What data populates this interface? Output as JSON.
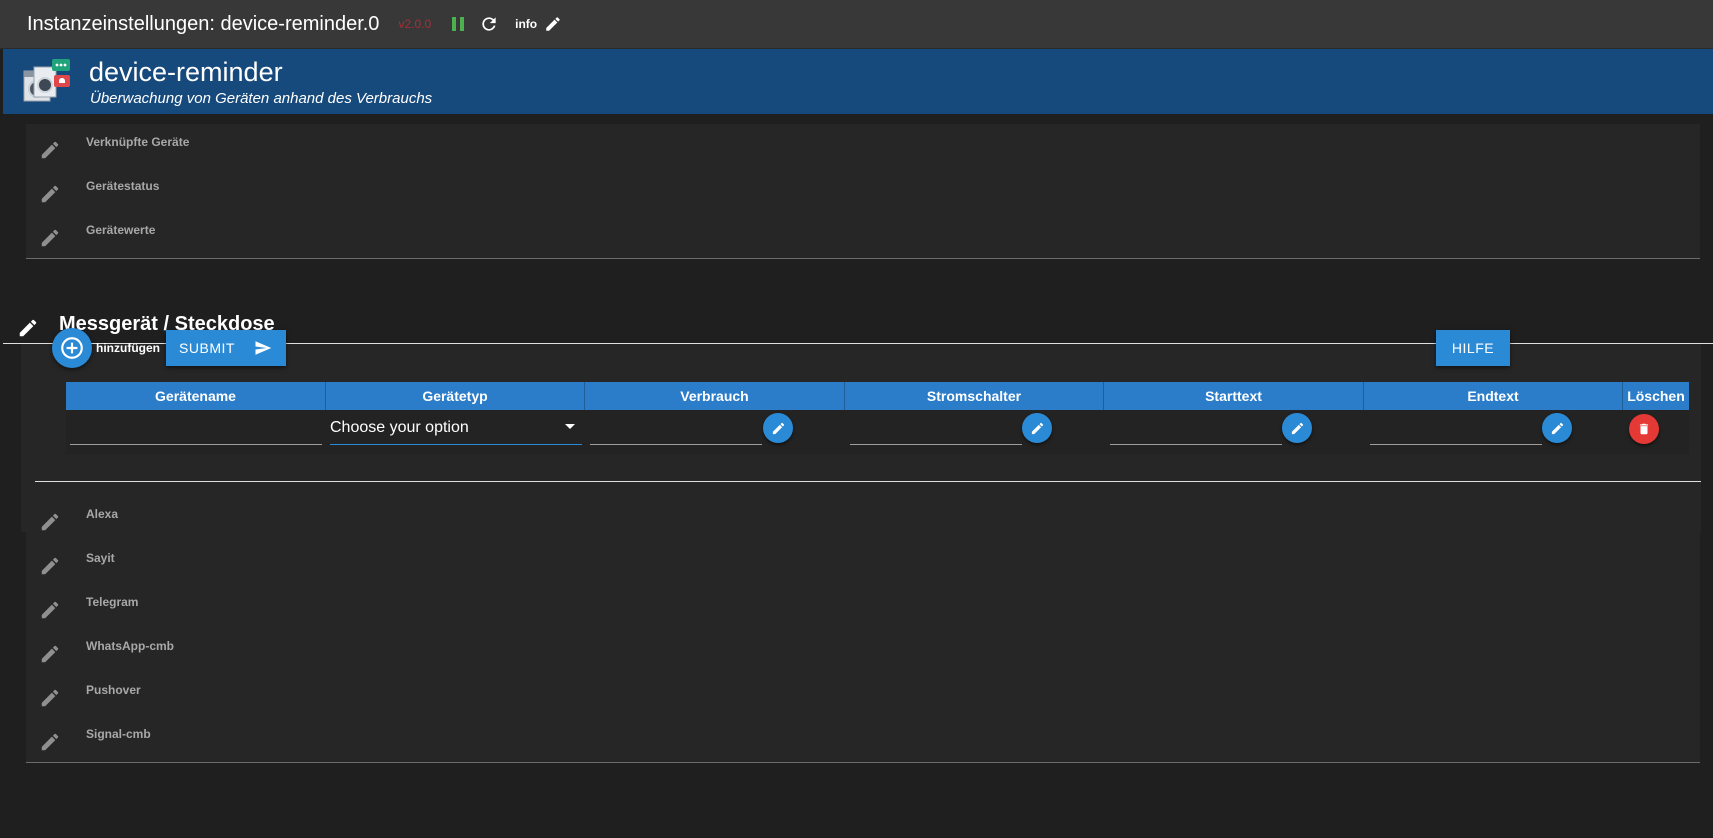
{
  "topbar": {
    "title": "Instanzeinstellungen: device-reminder.0",
    "version": "v2.0.0",
    "info_label": "info",
    "icons": [
      "pause-icon",
      "reload-icon",
      "edit-icon"
    ]
  },
  "header": {
    "name": "device-reminder",
    "description": "Überwachung von Geräten anhand des Verbrauchs"
  },
  "panels_top": [
    {
      "label": "Verknüpfte Geräte",
      "icon": "pencil-icon"
    },
    {
      "label": "Gerätestatus",
      "icon": "pencil-icon"
    },
    {
      "label": "Gerätewerte",
      "icon": "pencil-icon"
    }
  ],
  "section": {
    "title": "Messgerät / Steckdose",
    "add_label": "hinzufügen",
    "submit_label": "SUBMIT",
    "help_label": "HILFE",
    "columns": [
      "Gerätename",
      "Gerätetyp",
      "Verbrauch",
      "Stromschalter",
      "Starttext",
      "Endtext",
      "Löschen"
    ],
    "row": {
      "geraetename": "",
      "geraetetyp_placeholder": "Choose your option",
      "verbrauch": "",
      "stromschalter": "",
      "starttext": "",
      "endtext": ""
    }
  },
  "panels_bottom": [
    {
      "label": "Alexa",
      "icon": "pencil-icon"
    },
    {
      "label": "Sayit",
      "icon": "pencil-icon"
    },
    {
      "label": "Telegram",
      "icon": "pencil-icon"
    },
    {
      "label": "WhatsApp-cmb",
      "icon": "pencil-icon"
    },
    {
      "label": "Pushover",
      "icon": "pencil-icon"
    },
    {
      "label": "Signal-cmb",
      "icon": "pencil-icon"
    }
  ],
  "colors": {
    "accent": "#2b8ad6",
    "header_bg": "#174a7c",
    "delete": "#e53935",
    "pause": "#4caf50",
    "version": "#a3303a"
  }
}
